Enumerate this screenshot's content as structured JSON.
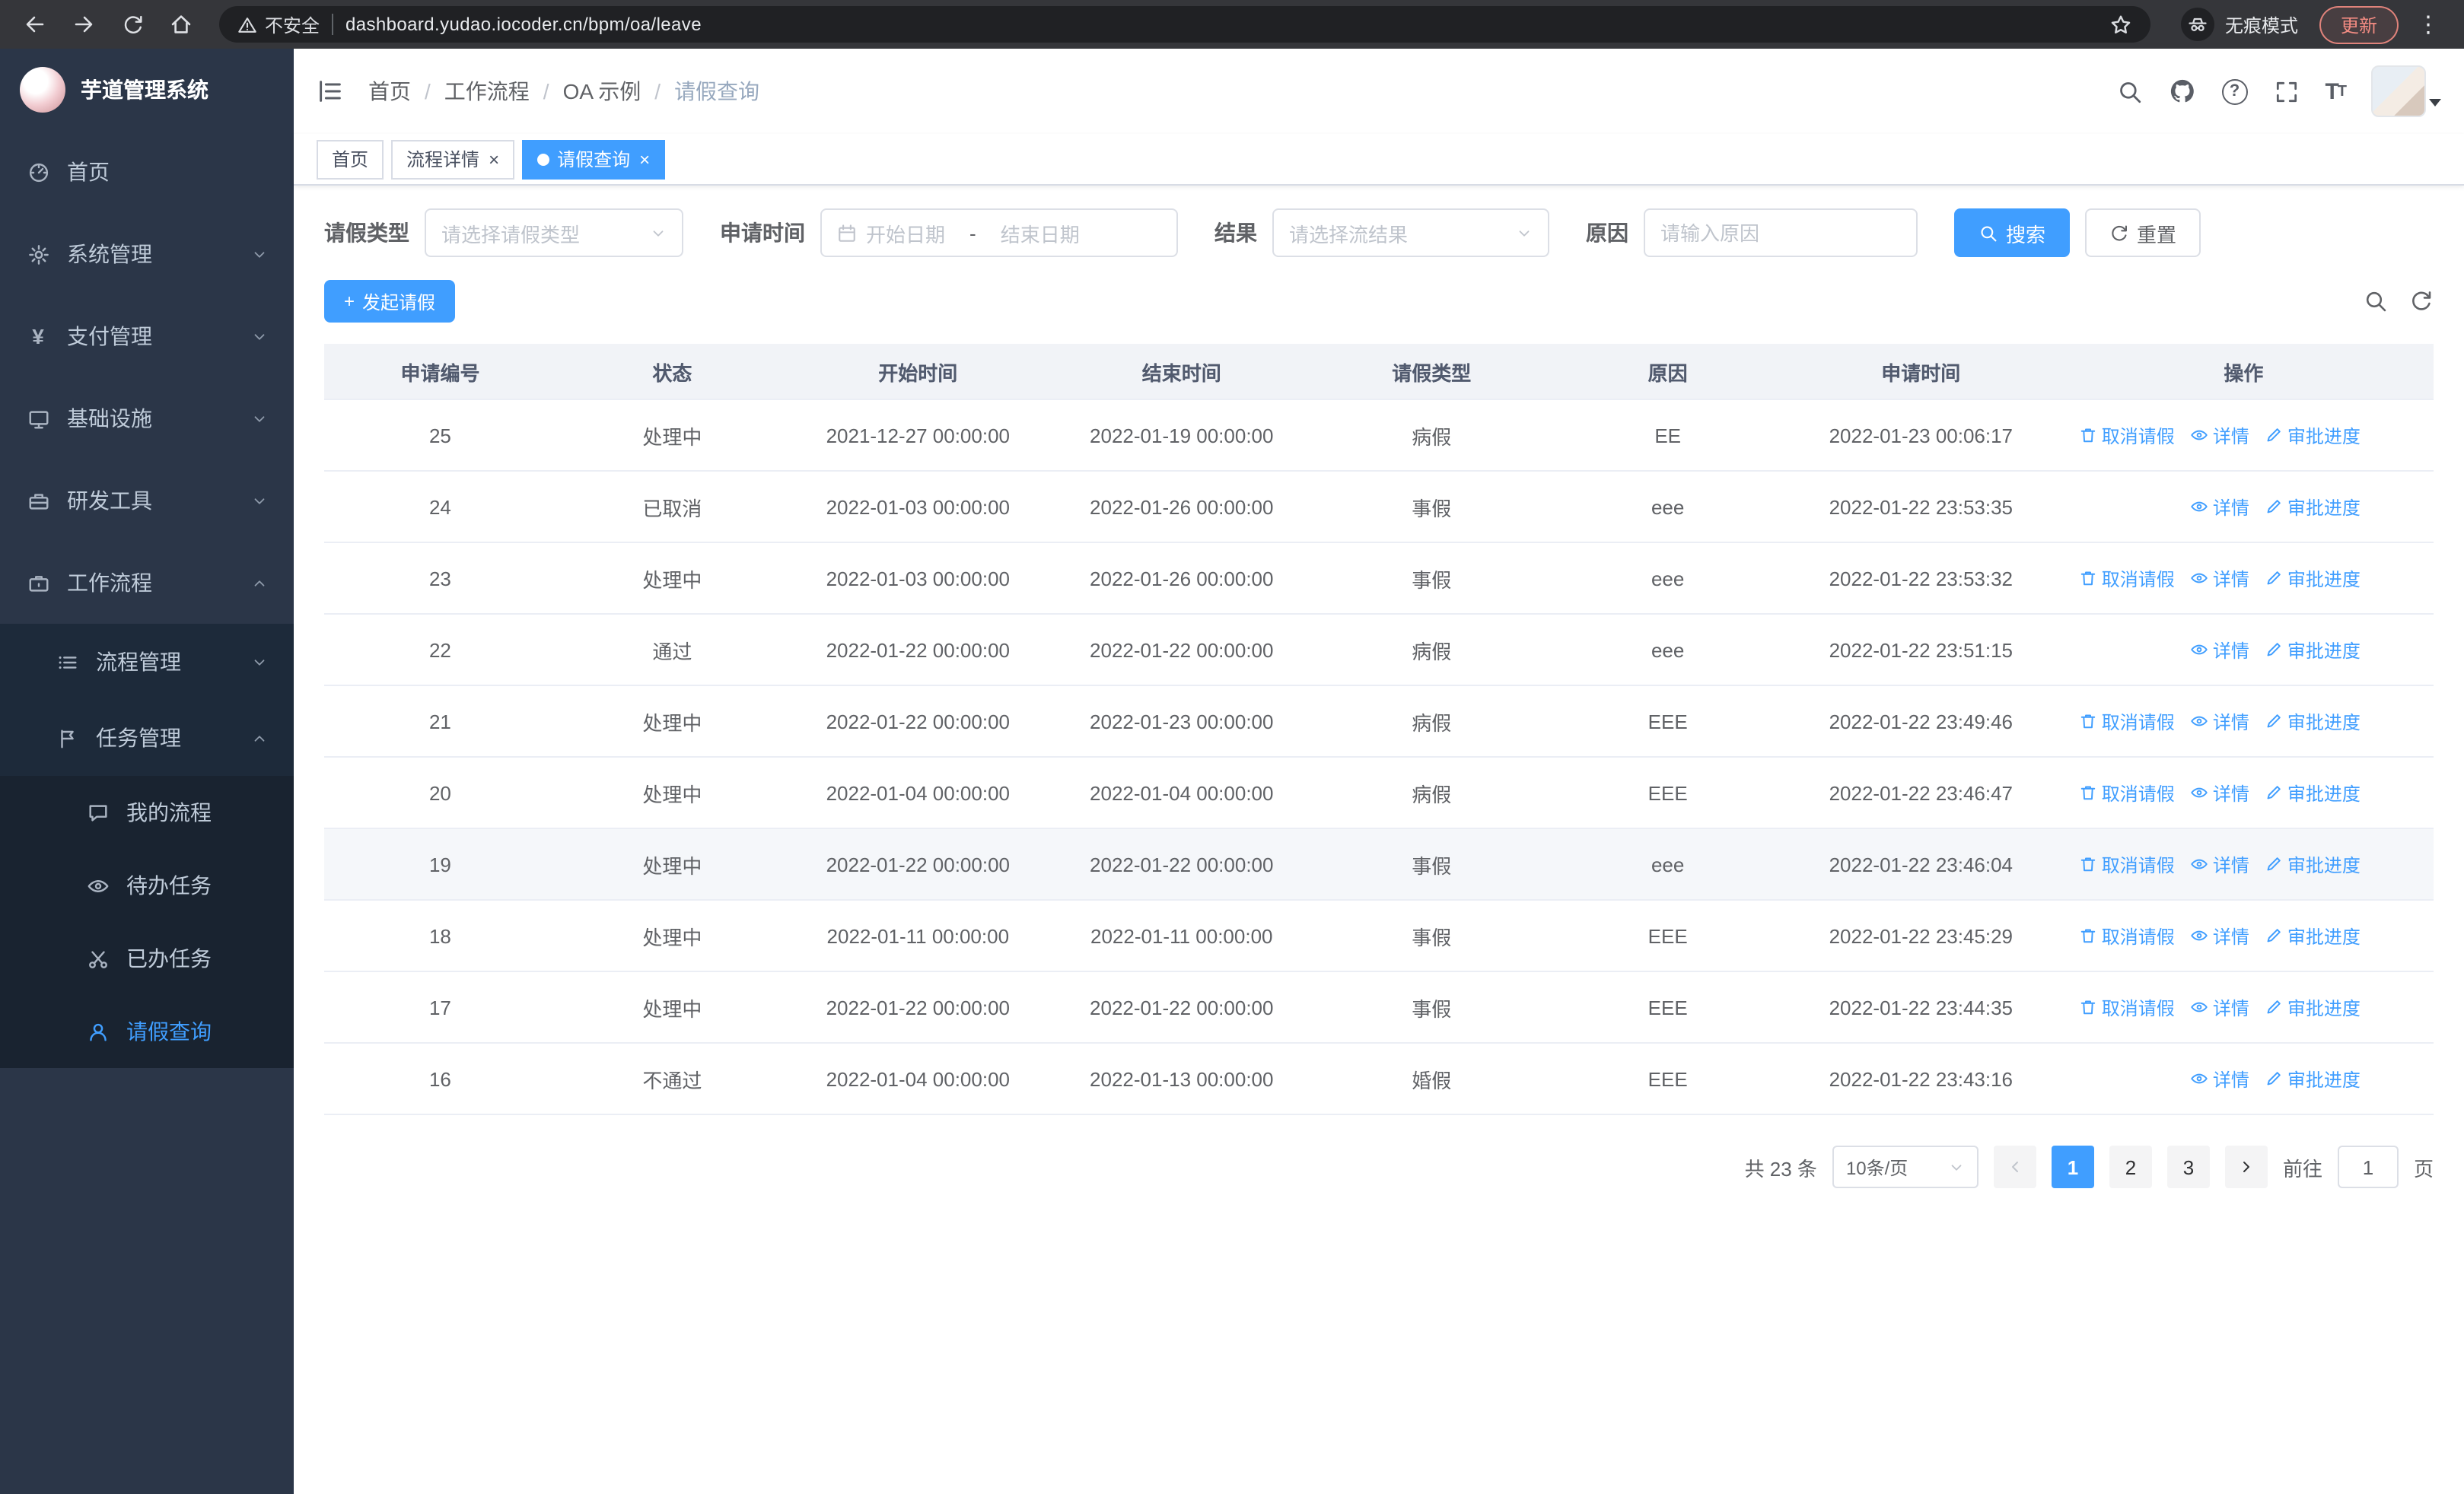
{
  "theme": {
    "accent": "#409eff",
    "sidebar_bg": "#2b3648",
    "submenu_bg": "#1d2a3a",
    "table_header_bg": "#f1f3f7"
  },
  "browser": {
    "security_warning": "不安全",
    "url": "dashboard.yudao.iocoder.cn/bpm/oa/leave",
    "incognito_label": "无痕模式",
    "update_label": "更新"
  },
  "sidebar": {
    "title": "芋道管理系统",
    "menu": [
      {
        "label": "首页",
        "icon": "dashboard-icon"
      },
      {
        "label": "系统管理",
        "icon": "gear-icon"
      },
      {
        "label": "支付管理",
        "icon": "yen-icon"
      },
      {
        "label": "基础设施",
        "icon": "monitor-icon"
      },
      {
        "label": "研发工具",
        "icon": "toolbox-icon"
      },
      {
        "label": "工作流程",
        "icon": "briefcase-icon"
      }
    ],
    "workflow_children": [
      {
        "label": "流程管理",
        "icon": "list-icon"
      },
      {
        "label": "任务管理",
        "icon": "flag-icon"
      }
    ],
    "task_children": [
      {
        "label": "我的流程",
        "icon": "chat-icon"
      },
      {
        "label": "待办任务",
        "icon": "eye-icon"
      },
      {
        "label": "已办任务",
        "icon": "scissors-icon"
      },
      {
        "label": "请假查询",
        "icon": "user-icon"
      }
    ]
  },
  "navbar": {
    "breadcrumb": [
      "首页",
      "工作流程",
      "OA 示例",
      "请假查询"
    ],
    "separator": "/"
  },
  "tags": [
    {
      "label": "首页"
    },
    {
      "label": "流程详情"
    },
    {
      "label": "请假查询"
    }
  ],
  "filters": {
    "leave_type_label": "请假类型",
    "leave_type_placeholder": "请选择请假类型",
    "apply_time_label": "申请时间",
    "start_placeholder": "开始日期",
    "range_separator": "-",
    "end_placeholder": "结束日期",
    "result_label": "结果",
    "result_placeholder": "请选择流结果",
    "reason_label": "原因",
    "reason_placeholder": "请输入原因",
    "search_button": "搜索",
    "reset_button": "重置"
  },
  "toolbar": {
    "create_button": "发起请假"
  },
  "table": {
    "columns": [
      "申请编号",
      "状态",
      "开始时间",
      "结束时间",
      "请假类型",
      "原因",
      "申请时间",
      "操作"
    ],
    "rows": [
      {
        "id": "25",
        "status": "处理中",
        "start": "2021-12-27 00:00:00",
        "end": "2022-01-19 00:00:00",
        "type": "病假",
        "reason": "EE",
        "applied": "2022-01-23 00:06:17",
        "highlight": false,
        "actions": [
          {
            "name": "cancel",
            "icon": "trash-icon",
            "label": "取消请假"
          },
          {
            "name": "detail",
            "icon": "eye-icon",
            "label": "详情"
          },
          {
            "name": "progress",
            "icon": "edit-icon",
            "label": "审批进度"
          }
        ]
      },
      {
        "id": "24",
        "status": "已取消",
        "start": "2022-01-03 00:00:00",
        "end": "2022-01-26 00:00:00",
        "type": "事假",
        "reason": "eee",
        "applied": "2022-01-22 23:53:35",
        "highlight": false,
        "actions": [
          {
            "name": "detail",
            "icon": "eye-icon",
            "label": "详情"
          },
          {
            "name": "progress",
            "icon": "edit-icon",
            "label": "审批进度"
          }
        ]
      },
      {
        "id": "23",
        "status": "处理中",
        "start": "2022-01-03 00:00:00",
        "end": "2022-01-26 00:00:00",
        "type": "事假",
        "reason": "eee",
        "applied": "2022-01-22 23:53:32",
        "highlight": false,
        "actions": [
          {
            "name": "cancel",
            "icon": "trash-icon",
            "label": "取消请假"
          },
          {
            "name": "detail",
            "icon": "eye-icon",
            "label": "详情"
          },
          {
            "name": "progress",
            "icon": "edit-icon",
            "label": "审批进度"
          }
        ]
      },
      {
        "id": "22",
        "status": "通过",
        "start": "2022-01-22 00:00:00",
        "end": "2022-01-22 00:00:00",
        "type": "病假",
        "reason": "eee",
        "applied": "2022-01-22 23:51:15",
        "highlight": false,
        "actions": [
          {
            "name": "detail",
            "icon": "eye-icon",
            "label": "详情"
          },
          {
            "name": "progress",
            "icon": "edit-icon",
            "label": "审批进度"
          }
        ]
      },
      {
        "id": "21",
        "status": "处理中",
        "start": "2022-01-22 00:00:00",
        "end": "2022-01-23 00:00:00",
        "type": "病假",
        "reason": "EEE",
        "applied": "2022-01-22 23:49:46",
        "highlight": false,
        "actions": [
          {
            "name": "cancel",
            "icon": "trash-icon",
            "label": "取消请假"
          },
          {
            "name": "detail",
            "icon": "eye-icon",
            "label": "详情"
          },
          {
            "name": "progress",
            "icon": "edit-icon",
            "label": "审批进度"
          }
        ]
      },
      {
        "id": "20",
        "status": "处理中",
        "start": "2022-01-04 00:00:00",
        "end": "2022-01-04 00:00:00",
        "type": "病假",
        "reason": "EEE",
        "applied": "2022-01-22 23:46:47",
        "highlight": false,
        "actions": [
          {
            "name": "cancel",
            "icon": "trash-icon",
            "label": "取消请假"
          },
          {
            "name": "detail",
            "icon": "eye-icon",
            "label": "详情"
          },
          {
            "name": "progress",
            "icon": "edit-icon",
            "label": "审批进度"
          }
        ]
      },
      {
        "id": "19",
        "status": "处理中",
        "start": "2022-01-22 00:00:00",
        "end": "2022-01-22 00:00:00",
        "type": "事假",
        "reason": "eee",
        "applied": "2022-01-22 23:46:04",
        "highlight": true,
        "actions": [
          {
            "name": "cancel",
            "icon": "trash-icon",
            "label": "取消请假"
          },
          {
            "name": "detail",
            "icon": "eye-icon",
            "label": "详情"
          },
          {
            "name": "progress",
            "icon": "edit-icon",
            "label": "审批进度"
          }
        ]
      },
      {
        "id": "18",
        "status": "处理中",
        "start": "2022-01-11 00:00:00",
        "end": "2022-01-11 00:00:00",
        "type": "事假",
        "reason": "EEE",
        "applied": "2022-01-22 23:45:29",
        "highlight": false,
        "actions": [
          {
            "name": "cancel",
            "icon": "trash-icon",
            "label": "取消请假"
          },
          {
            "name": "detail",
            "icon": "eye-icon",
            "label": "详情"
          },
          {
            "name": "progress",
            "icon": "edit-icon",
            "label": "审批进度"
          }
        ]
      },
      {
        "id": "17",
        "status": "处理中",
        "start": "2022-01-22 00:00:00",
        "end": "2022-01-22 00:00:00",
        "type": "事假",
        "reason": "EEE",
        "applied": "2022-01-22 23:44:35",
        "highlight": false,
        "actions": [
          {
            "name": "cancel",
            "icon": "trash-icon",
            "label": "取消请假"
          },
          {
            "name": "detail",
            "icon": "eye-icon",
            "label": "详情"
          },
          {
            "name": "progress",
            "icon": "edit-icon",
            "label": "审批进度"
          }
        ]
      },
      {
        "id": "16",
        "status": "不通过",
        "start": "2022-01-04 00:00:00",
        "end": "2022-01-13 00:00:00",
        "type": "婚假",
        "reason": "EEE",
        "applied": "2022-01-22 23:43:16",
        "highlight": false,
        "actions": [
          {
            "name": "detail",
            "icon": "eye-icon",
            "label": "详情"
          },
          {
            "name": "progress",
            "icon": "edit-icon",
            "label": "审批进度"
          }
        ]
      }
    ]
  },
  "pagination": {
    "total": "共 23 条",
    "page_size": "10条/页",
    "pages": [
      "1",
      "2",
      "3"
    ],
    "active_page": "1",
    "goto_label": "前往",
    "goto_value": "1",
    "goto_unit": "页"
  }
}
